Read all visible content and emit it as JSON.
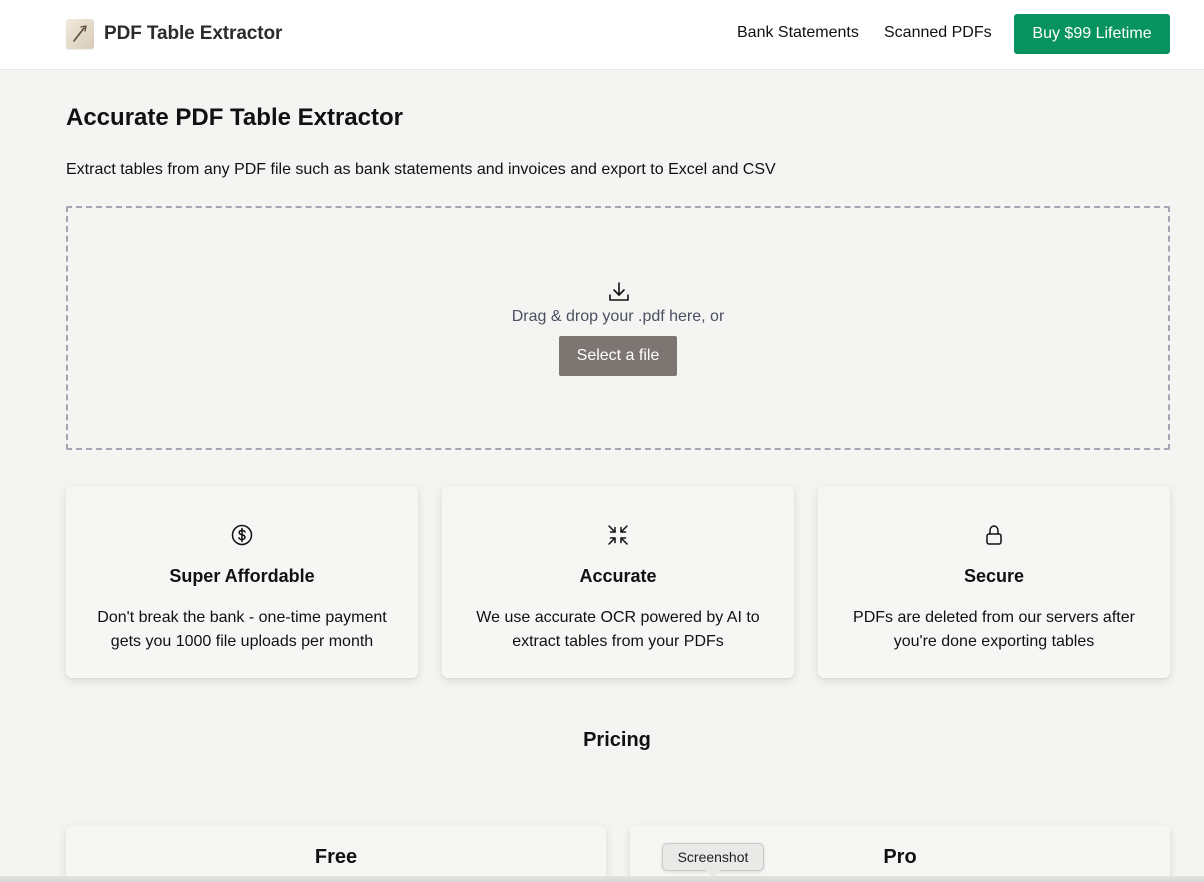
{
  "header": {
    "brand_name": "PDF Table Extractor",
    "logo_icon": "pdf-scroll-logo-icon",
    "nav": {
      "bank_statements": "Bank Statements",
      "scanned_pdfs": "Scanned PDFs"
    },
    "buy_button": "Buy $99 Lifetime"
  },
  "main": {
    "title": "Accurate PDF Table Extractor",
    "subtitle": "Extract tables from any PDF file such as bank statements and invoices and export to Excel and CSV"
  },
  "dropzone": {
    "icon": "download-icon",
    "text": "Drag & drop your .pdf here, or",
    "select_button": "Select a file"
  },
  "features": [
    {
      "icon": "dollar-circle-icon",
      "title": "Super Affordable",
      "description": "Don't break the bank - one-time payment gets you 1000 file uploads per month"
    },
    {
      "icon": "shrink-arrows-icon",
      "title": "Accurate",
      "description": "We use accurate OCR powered by AI to extract tables from your PDFs"
    },
    {
      "icon": "lock-icon",
      "title": "Secure",
      "description": "PDFs are deleted from our servers after you're done exporting tables"
    }
  ],
  "pricing": {
    "heading": "Pricing",
    "plans": [
      {
        "name": "Free"
      },
      {
        "name": "Pro"
      }
    ]
  },
  "tooltip": {
    "text": "Screenshot"
  },
  "colors": {
    "page_background": "#f4f4f2",
    "brand_green": "#07935f",
    "select_button": "#7d7572",
    "dropzone_border": "#a4a5b4"
  }
}
